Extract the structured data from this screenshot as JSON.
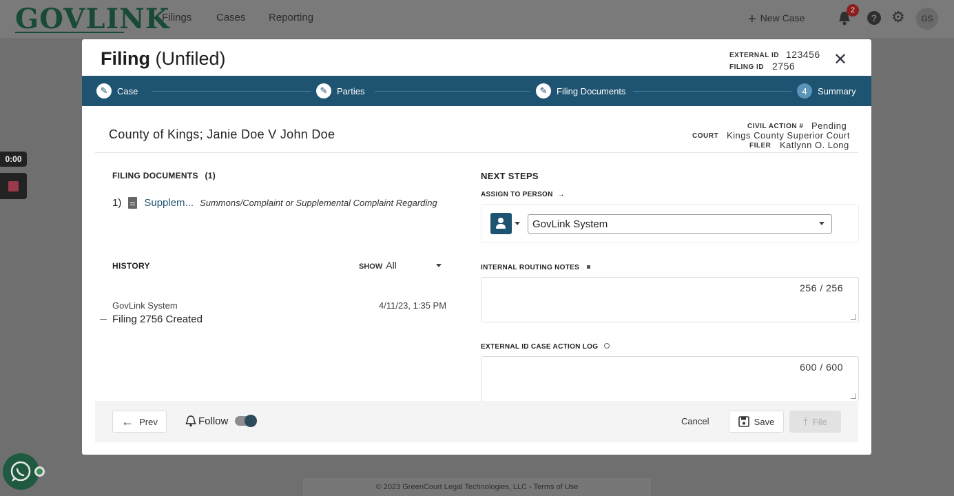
{
  "app": {
    "logo_text": "GOVLINK",
    "nav": [
      "Filings",
      "Cases",
      "Reporting"
    ],
    "new_case_label": "New Case",
    "notification_count": "2",
    "avatar_initials": "GS"
  },
  "recording": {
    "time": "0:00"
  },
  "modal": {
    "title_bold": "Filing",
    "title_status": "(Unfiled)",
    "external_id_label": "EXTERNAL ID",
    "external_id": "123456",
    "filing_id_label": "FILING ID",
    "filing_id": "2756",
    "steps": [
      {
        "label": "Case"
      },
      {
        "label": "Parties"
      },
      {
        "label": "Filing Documents"
      },
      {
        "label": "Summary",
        "number": "4"
      }
    ],
    "case_title": "County of Kings; Janie Doe V John Doe",
    "case_meta": {
      "civil_action_label": "CIVIL ACTION #",
      "civil_action": "Pending",
      "court_label": "COURT",
      "court": "Kings County Superior Court",
      "filer_label": "FILER",
      "filer": "Katlynn O. Long"
    },
    "filing_documents": {
      "heading": "FILING DOCUMENTS",
      "count": "(1)",
      "items": [
        {
          "index": "1)",
          "name": "Supplem...",
          "description": "Summons/Complaint or Supplemental Complaint Regarding"
        }
      ]
    },
    "history": {
      "heading": "HISTORY",
      "show_label": "SHOW",
      "show_value": "All",
      "entries": [
        {
          "who": "GovLink System",
          "when": "4/11/23, 1:35 PM",
          "event": "Filing 2756 Created"
        }
      ]
    },
    "next_steps": {
      "heading": "NEXT STEPS",
      "assign_label": "ASSIGN TO PERSON",
      "assignee": "GovLink System",
      "routing_label": "INTERNAL ROUTING NOTES",
      "routing_counter": "256 / 256",
      "action_log_label": "EXTERNAL ID CASE ACTION LOG",
      "action_log_counter": "600 / 600"
    },
    "actions": {
      "prev": "Prev",
      "follow": "Follow",
      "follow_on": true,
      "cancel": "Cancel",
      "save": "Save",
      "file": "File"
    }
  },
  "footer": {
    "text": "© 2023 GreenCourt Legal Technologies, LLC - Terms of Use"
  }
}
